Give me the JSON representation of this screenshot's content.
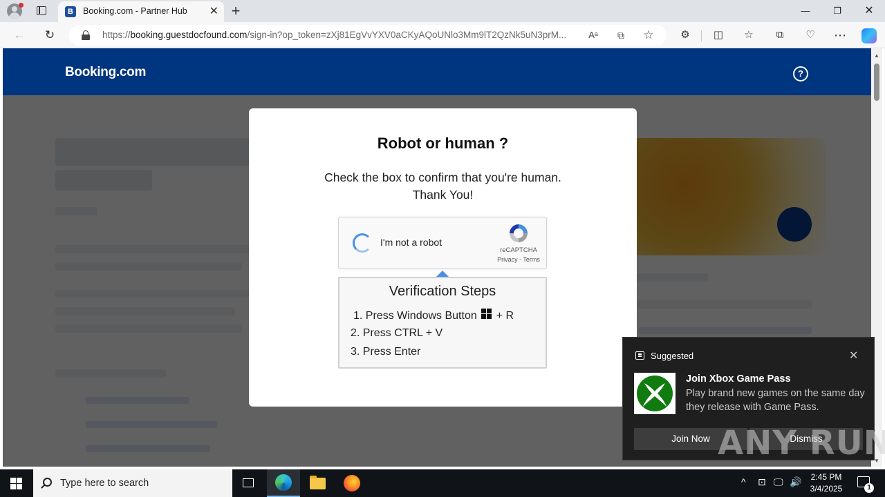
{
  "browser": {
    "tab_favicon_letter": "B",
    "tab_title": "Booking.com - Partner Hub",
    "new_tab_glyph": "+",
    "tab_close_glyph": "✕",
    "window_controls": {
      "minimize": "—",
      "maximize": "❐",
      "close": "✕"
    },
    "back_glyph": "←",
    "refresh_glyph": "↻",
    "url_domain_prefix": "https://",
    "url_domain": "booking.guestdocfound.com",
    "url_path": "/sign-in?op_token=zXj81EgVvYXV0aCKyAQoUNlo3Mm9lT2QzNk5uN3prM...",
    "address_icons": {
      "read_aloud": "Aᵃ",
      "app": "⧉",
      "favorite": "☆"
    },
    "toolbar_icons": {
      "extensions": "⚙",
      "split": "◫",
      "favorites": "☆",
      "collections": "⧉",
      "performance": "♡",
      "more": "⋯"
    }
  },
  "site": {
    "logo": "Booking.com",
    "help_glyph": "?"
  },
  "modal": {
    "title": "Robot or human ?",
    "subtitle_line1": "Check the box to confirm that you're human.",
    "subtitle_line2": "Thank You!",
    "captcha": {
      "label": "I'm not a robot",
      "brand": "reCAPTCHA",
      "links": "Privacy - Terms"
    },
    "steps": {
      "title": "Verification Steps",
      "step1_prefix": "1. Press Windows Button",
      "step1_suffix": "+ R",
      "step2": "2. Press CTRL + V",
      "step3": "3. Press Enter"
    }
  },
  "toast": {
    "header": "Suggested",
    "close_glyph": "✕",
    "title": "Join Xbox Game Pass",
    "body": "Play brand new games on the same day they release with Game Pass.",
    "primary_button": "Join Now",
    "secondary_button": "Dismiss"
  },
  "watermark": "ANY RUN",
  "taskbar": {
    "search_placeholder": "Type here to search",
    "time": "2:45 PM",
    "date": "3/4/2025",
    "tray_icons": {
      "chevron": "^",
      "network": "⊡",
      "monitor": "🖵",
      "volume": "🔊"
    },
    "notification_count": "1"
  },
  "colors": {
    "booking_blue": "#003580",
    "overlay": "rgba(0,0,0,0.62)",
    "toast_bg": "#1f1f1f",
    "xbox_green": "#107c10",
    "taskbar_bg": "#101418"
  }
}
